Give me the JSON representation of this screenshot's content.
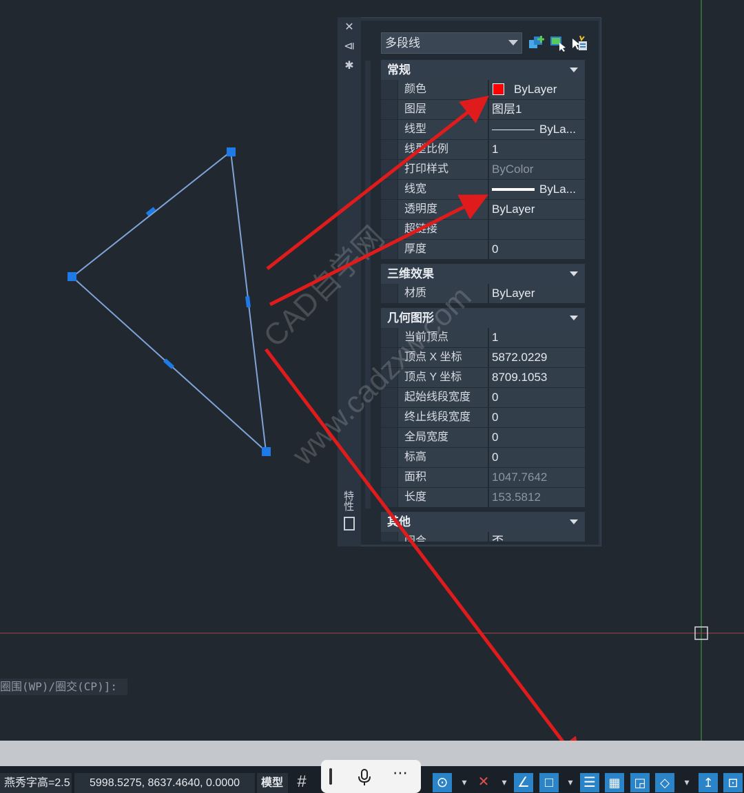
{
  "palette": {
    "object_type": "多段线",
    "side_tab_label": "特性",
    "sections": {
      "general": {
        "title": "常规",
        "rows": [
          {
            "key": "颜色",
            "value": "ByLayer"
          },
          {
            "key": "图层",
            "value": "图层1"
          },
          {
            "key": "线型",
            "value": "ByLa..."
          },
          {
            "key": "线型比例",
            "value": "1"
          },
          {
            "key": "打印样式",
            "value": "ByColor"
          },
          {
            "key": "线宽",
            "value": "ByLa..."
          },
          {
            "key": "透明度",
            "value": "ByLayer"
          },
          {
            "key": "超链接",
            "value": ""
          },
          {
            "key": "厚度",
            "value": "0"
          }
        ]
      },
      "3d": {
        "title": "三维效果",
        "rows": [
          {
            "key": "材质",
            "value": "ByLayer"
          }
        ]
      },
      "geometry": {
        "title": "几何图形",
        "rows": [
          {
            "key": "当前顶点",
            "value": "1"
          },
          {
            "key": "顶点 X 坐标",
            "value": "5872.0229"
          },
          {
            "key": "顶点 Y 坐标",
            "value": "8709.1053"
          },
          {
            "key": "起始线段宽度",
            "value": "0"
          },
          {
            "key": "终止线段宽度",
            "value": "0"
          },
          {
            "key": "全局宽度",
            "value": "0"
          },
          {
            "key": "标高",
            "value": "0"
          },
          {
            "key": "面积",
            "value": "1047.7642"
          },
          {
            "key": "长度",
            "value": "153.5812"
          }
        ]
      },
      "misc": {
        "title": "其他",
        "rows": [
          {
            "key": "闭合",
            "value": "否"
          }
        ]
      }
    }
  },
  "command_line": {
    "text": "圈围(WP)/圈交(CP)]:"
  },
  "status_bar": {
    "text_height": "燕秀字高=2.5",
    "coordinates": "5998.5275, 8637.4640, 0.0000",
    "model_tab": "模型"
  },
  "watermark": {
    "line1": "CAD自学网",
    "line2": "www.cadzxw.com"
  },
  "colors": {
    "background": "#212830",
    "selection": "#1e7ae6",
    "annotation_arrow": "#e01b1b",
    "color_swatch": "#ff0000"
  }
}
